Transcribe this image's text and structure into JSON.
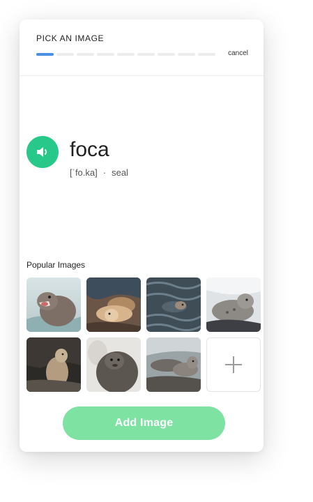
{
  "header": {
    "title": "PICK AN IMAGE",
    "cancel_label": "cancel",
    "progress": {
      "steps": 9,
      "current": 1
    }
  },
  "word": {
    "text": "foca",
    "pronunciation": "[ˈfo.ka]",
    "separator": "·",
    "translation": "seal",
    "audio_icon": "speaker-icon"
  },
  "popular": {
    "label": "Popular Images",
    "images": [
      {
        "name": "seal-image-1"
      },
      {
        "name": "seal-image-2"
      },
      {
        "name": "seal-image-3"
      },
      {
        "name": "seal-image-4"
      },
      {
        "name": "seal-image-5"
      },
      {
        "name": "seal-image-6"
      },
      {
        "name": "seal-image-7"
      }
    ],
    "add_tile_icon": "plus-icon"
  },
  "footer": {
    "add_button_label": "Add Image"
  },
  "colors": {
    "accent": "#27c88a",
    "progress_active": "#4a90e2",
    "button": "#7ee3a2"
  }
}
